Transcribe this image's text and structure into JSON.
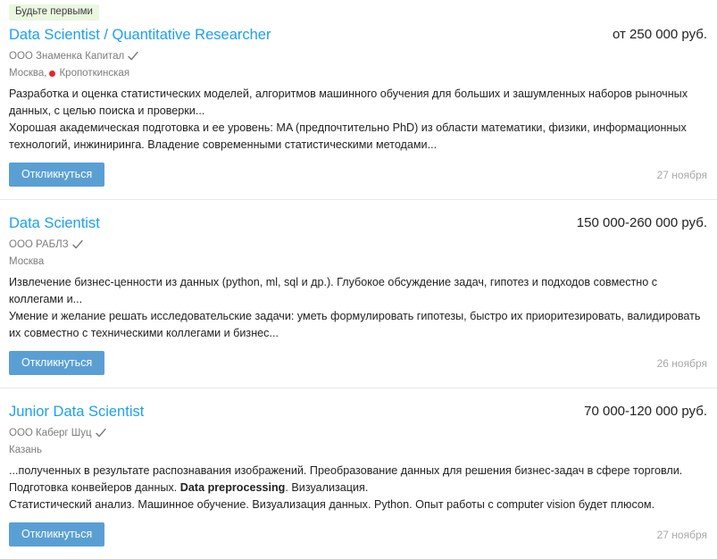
{
  "colors": {
    "link_blue": "#1ca0f0",
    "apply_button_bg": "#5a9fd4",
    "badge_bg": "#eaf7e0",
    "metro_red": "#e8252a",
    "muted_text": "#7d7d7d",
    "date_text": "#a8a8a8",
    "divider": "#e8e8e8"
  },
  "icons": {
    "verified": "check-icon",
    "metro": "metro-dot-icon"
  },
  "common": {
    "apply_label": "Откликнуться"
  },
  "vacancies": [
    {
      "badge": "Будьте первыми",
      "title": "Data Scientist / Quantitative Researcher",
      "salary": "от 250 000 руб.",
      "company": "ООО Знаменка Капитал",
      "verified": true,
      "city": "Москва,",
      "metro": "Кропоткинская",
      "metro_color": "#e8252a",
      "snippet_responsibility": "Разработка и оценка статистических моделей, алгоритмов машинного обучения для больших и зашумленных наборов рыночных данных, с целью поиска и проверки...",
      "snippet_requirement": "Хорошая академическая подготовка и ее уровень: MA (предпочтительно PhD) из области математики, физики, информационных технологий, инжиниринга. Владение современными статистическими методами...",
      "apply_label": "Откликнуться",
      "date": "27 ноября"
    },
    {
      "badge": "",
      "title": "Data Scientist",
      "salary": "150 000-260 000 руб.",
      "company": "ООО РАБЛЗ",
      "verified": true,
      "city": "Москва",
      "metro": "",
      "metro_color": "",
      "snippet_responsibility": "Извлечение бизнес-ценности из данных (python, ml, sql и др.). Глубокое обсуждение задач, гипотез и подходов совместно с коллегами и...",
      "snippet_requirement": "Умение и желание решать исследовательские задачи: уметь формулировать гипотезы, быстро их приоритезировать, валидировать их совместно с техническими коллегами и бизнес...",
      "apply_label": "Откликнуться",
      "date": "26 ноября"
    },
    {
      "badge": "",
      "title": "Junior Data Scientist",
      "salary": "70 000-120 000 руб.",
      "company": "ООО Каберг Шуц",
      "verified": true,
      "city": "Казань",
      "metro": "",
      "metro_color": "",
      "snippet_responsibility_pre": "...полученных в результате распознавания изображений. Преобразование данных для решения бизнес-задач в сфере торговли. Подготовка конвейеров данных. ",
      "snippet_responsibility_bold": "Data preprocessing",
      "snippet_responsibility_post": ". Визуализация.",
      "snippet_requirement": "Статистический анализ. Машинное обучение. Визуализация данных. Python. Опыт работы с computer vision будет плюсом.",
      "apply_label": "Откликнуться",
      "date": "27 ноября"
    }
  ]
}
